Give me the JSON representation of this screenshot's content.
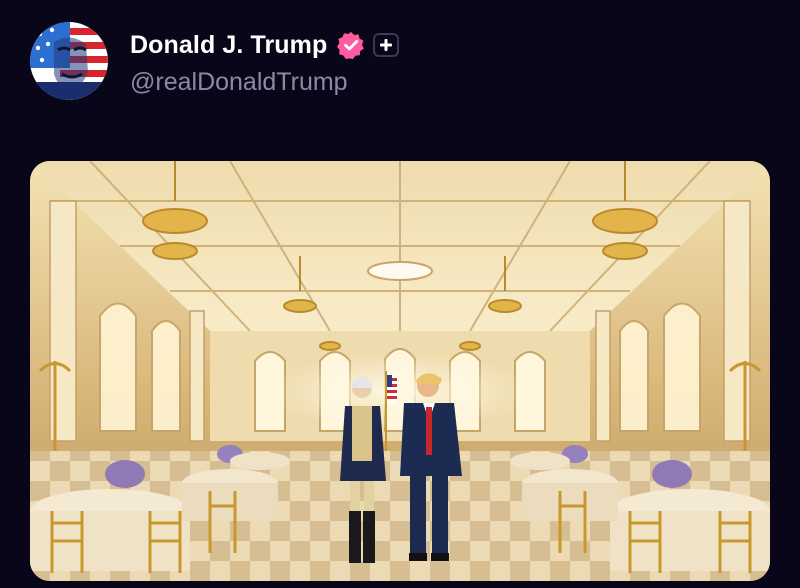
{
  "post": {
    "author": {
      "display_name": "Donald J. Trump",
      "handle": "@realDonaldTrump",
      "verified_icon": "verified-badge-icon",
      "follow_icon": "plus-icon"
    },
    "media": {
      "type": "image",
      "subject": "ballroom-painting"
    }
  },
  "colors": {
    "background": "#0a0619",
    "name": "#ffffff",
    "handle": "#8c8aa3",
    "verified": "#ff5ba0"
  }
}
